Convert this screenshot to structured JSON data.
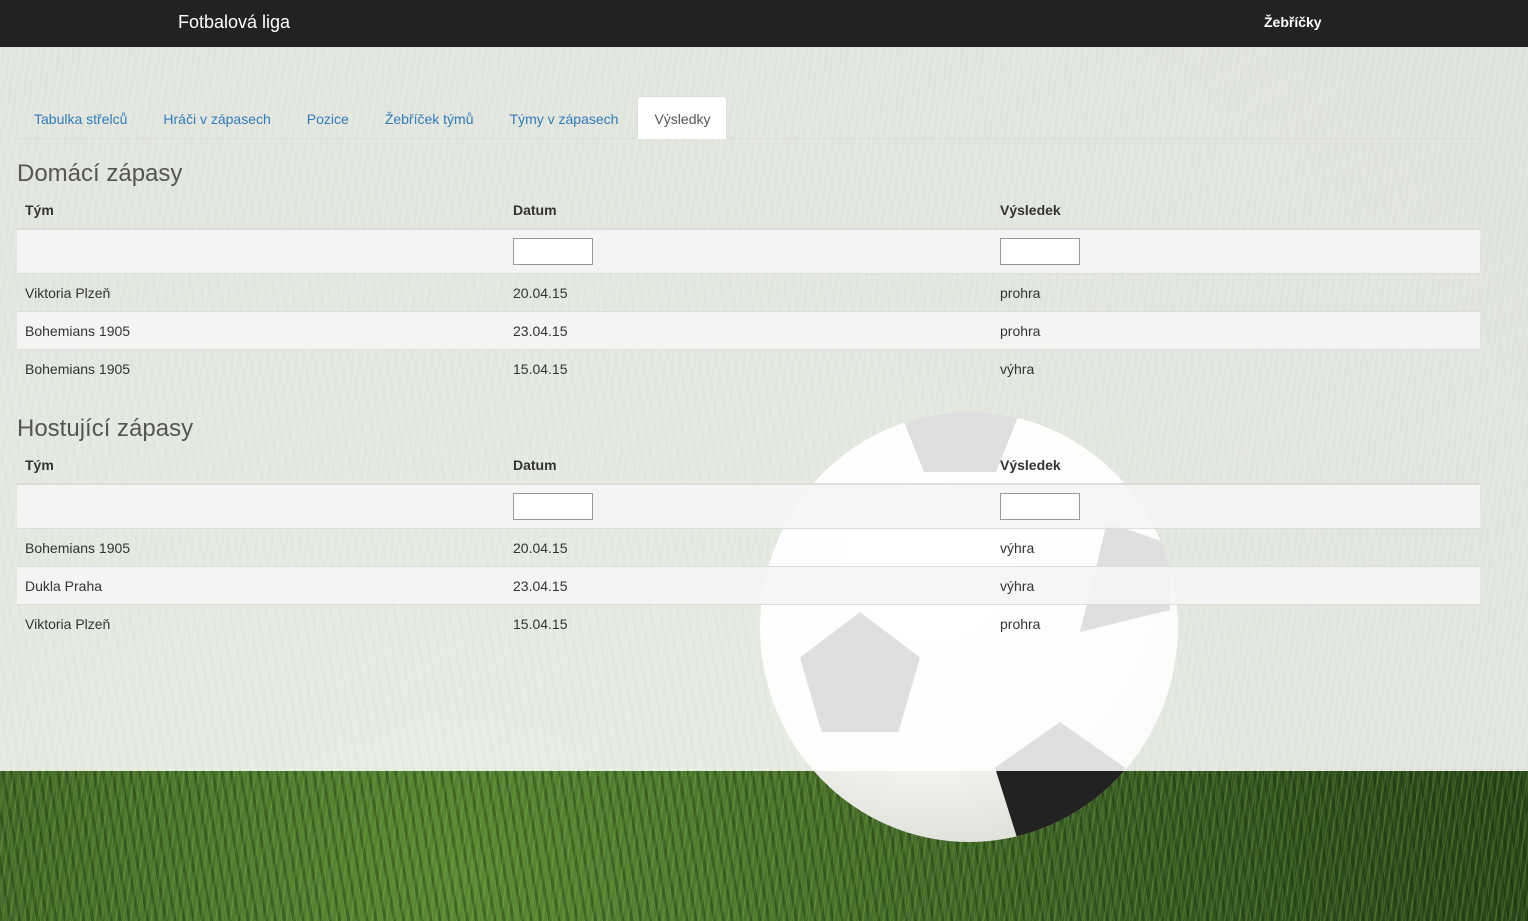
{
  "navbar": {
    "brand": "Fotbalová liga",
    "link": "Žebříčky"
  },
  "tabs": [
    {
      "label": "Tabulka střelců",
      "active": false
    },
    {
      "label": "Hráči v zápasech",
      "active": false
    },
    {
      "label": "Pozice",
      "active": false
    },
    {
      "label": "Žebříček týmů",
      "active": false
    },
    {
      "label": "Týmy v zápasech",
      "active": false
    },
    {
      "label": "Výsledky",
      "active": true
    }
  ],
  "home": {
    "title": "Domácí zápasy",
    "headers": [
      "Tým",
      "Datum",
      "Výsledek"
    ],
    "filters": {
      "datum": "",
      "vysledek": ""
    },
    "rows": [
      [
        "Viktoria Plzeň",
        "20.04.15",
        "prohra"
      ],
      [
        "Bohemians 1905",
        "23.04.15",
        "prohra"
      ],
      [
        "Bohemians 1905",
        "15.04.15",
        "výhra"
      ]
    ]
  },
  "away": {
    "title": "Hostující zápasy",
    "headers": [
      "Tým",
      "Datum",
      "Výsledek"
    ],
    "filters": {
      "datum": "",
      "vysledek": ""
    },
    "rows": [
      [
        "Bohemians 1905",
        "20.04.15",
        "výhra"
      ],
      [
        "Dukla Praha",
        "23.04.15",
        "výhra"
      ],
      [
        "Viktoria Plzeň",
        "15.04.15",
        "prohra"
      ]
    ]
  },
  "colors": {
    "navbar": "#222222",
    "link": "#337ab7",
    "accent_white": "#ffffff"
  }
}
